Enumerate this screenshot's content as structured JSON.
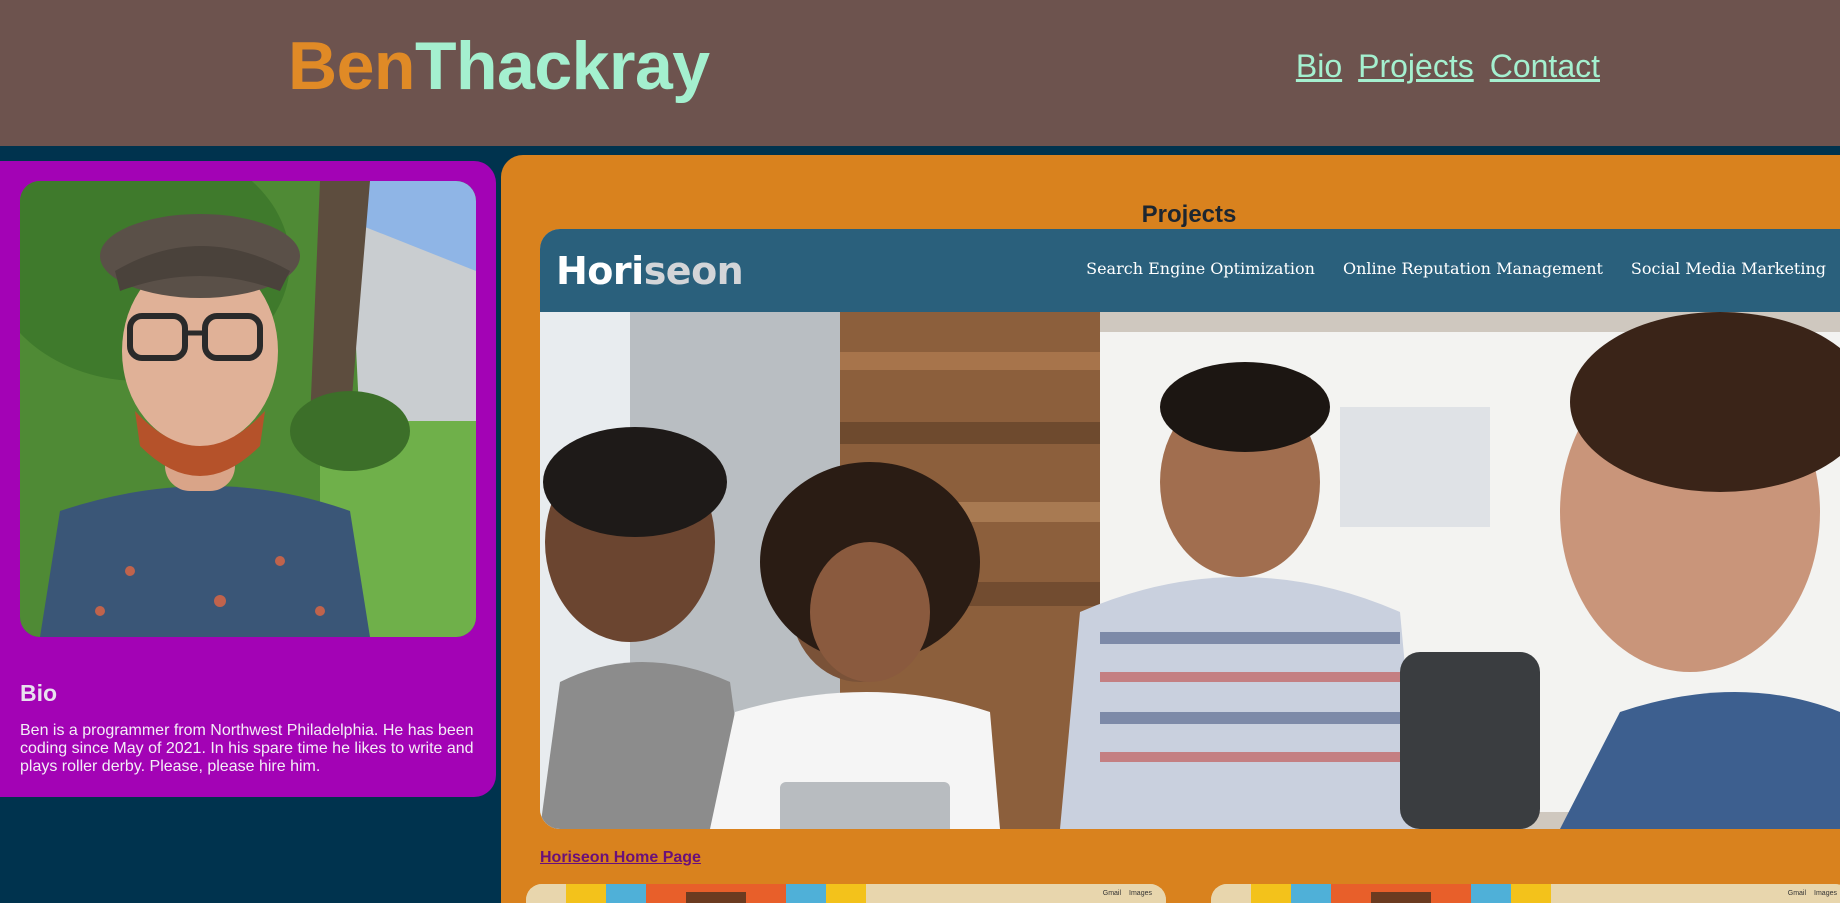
{
  "header": {
    "brand_first": "Ben",
    "brand_last": "Thackray",
    "nav": [
      "Bio",
      "Projects",
      "Contact"
    ]
  },
  "bio": {
    "title": "Bio",
    "text": "Ben is a programmer from Northwest Philadelphia. He has been coding since May of 2021. In his spare time he likes to write and plays roller derby. Please, please hire him."
  },
  "projects": {
    "title": "Projects",
    "horiseon": {
      "logo_a": "Hori",
      "logo_b": "seon",
      "nav": [
        "Search Engine Optimization",
        "Online Reputation Management",
        "Social Media Marketing"
      ],
      "link": "Horiseon Home Page"
    },
    "thumb_nav": [
      "Gmail",
      "Images"
    ]
  },
  "colors": {
    "header_bg": "#6d534e",
    "page_bg": "#00334e",
    "brand_orange": "#e08a26",
    "brand_mint": "#a4f0cf",
    "bio_card": "#a303b5",
    "projects_panel": "#d9821e",
    "horiseon_header": "#2a607c"
  }
}
